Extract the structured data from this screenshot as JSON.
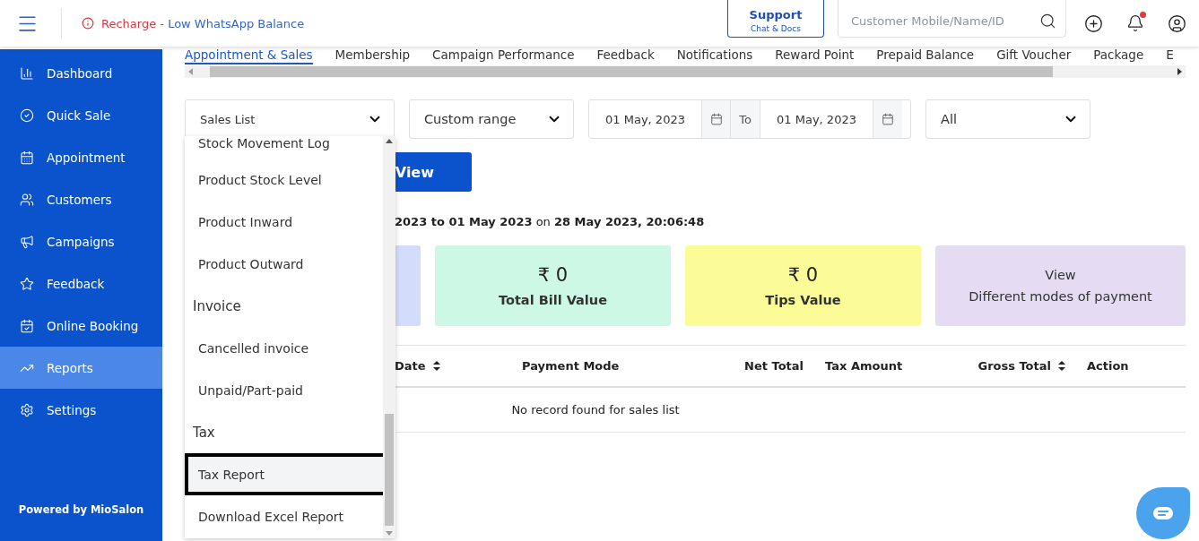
{
  "header": {
    "alert": {
      "action": "Recharge",
      "separator": " - ",
      "message": "Low WhatsApp Balance"
    },
    "support": {
      "title": "Support",
      "subtitle": "Chat & Docs"
    },
    "search": {
      "placeholder": "Customer Mobile/Name/ID"
    },
    "notification_dot": true
  },
  "sidebar": {
    "items": [
      {
        "label": "Dashboard",
        "selected": false
      },
      {
        "label": "Quick Sale",
        "selected": false
      },
      {
        "label": "Appointment",
        "selected": false
      },
      {
        "label": "Customers",
        "selected": false
      },
      {
        "label": "Campaigns",
        "selected": false
      },
      {
        "label": "Feedback",
        "selected": false
      },
      {
        "label": "Online Booking",
        "selected": false
      },
      {
        "label": "Reports",
        "selected": true
      },
      {
        "label": "Settings",
        "selected": false
      }
    ],
    "footer": "Powered by MioSalon"
  },
  "tabs": [
    {
      "label": "Appointment & Sales",
      "selected": true
    },
    {
      "label": "Membership",
      "selected": false
    },
    {
      "label": "Campaign Performance",
      "selected": false
    },
    {
      "label": "Feedback",
      "selected": false
    },
    {
      "label": "Notifications",
      "selected": false
    },
    {
      "label": "Reward Point",
      "selected": false
    },
    {
      "label": "Prepaid Balance",
      "selected": false
    },
    {
      "label": "Gift Voucher",
      "selected": false
    },
    {
      "label": "Package",
      "selected": false
    },
    {
      "label": "E",
      "selected": false
    }
  ],
  "filters": {
    "report": "Sales List",
    "range": "Custom range",
    "from": "01 May, 2023",
    "to_label": "To",
    "to": "01 May, 2023",
    "status": "All"
  },
  "report_menu": [
    {
      "kind": "option",
      "label": "Stock Movement Log",
      "selected": false
    },
    {
      "kind": "option",
      "label": "Product Stock Level",
      "selected": false
    },
    {
      "kind": "option",
      "label": "Product Inward",
      "selected": false
    },
    {
      "kind": "option",
      "label": "Product Outward",
      "selected": false
    },
    {
      "kind": "group",
      "label": "Invoice"
    },
    {
      "kind": "option",
      "label": "Cancelled invoice",
      "selected": false
    },
    {
      "kind": "option",
      "label": "Unpaid/Part-paid",
      "selected": false
    },
    {
      "kind": "group",
      "label": "Tax"
    },
    {
      "kind": "option",
      "label": "Tax Report",
      "selected": true
    },
    {
      "kind": "option",
      "label": "Download Excel Report",
      "selected": false
    }
  ],
  "view_button": "View",
  "summary": "**2023 to 01 May 2023** on **28 May 2023, 20:06:48**",
  "cards": [
    {
      "color": "#d3dcfb"
    },
    {
      "value": "₹ 0",
      "label": "Total Bill Value",
      "color": "#cdf8e6"
    },
    {
      "value": "₹ 0",
      "label": "Tips Value",
      "color": "#fbfb98"
    },
    {
      "value": "View",
      "label": "Different modes of payment",
      "color": "#e5dcf3"
    }
  ],
  "table": {
    "columns": [
      {
        "label": "Date",
        "sortable": true
      },
      {
        "label": "Payment Mode",
        "sortable": false
      },
      {
        "label": "Net Total",
        "sortable": false
      },
      {
        "label": "Tax Amount",
        "sortable": false
      },
      {
        "label": "Gross Total",
        "sortable": true
      },
      {
        "label": "Action",
        "sortable": false
      }
    ],
    "empty": "No record found for sales list"
  }
}
